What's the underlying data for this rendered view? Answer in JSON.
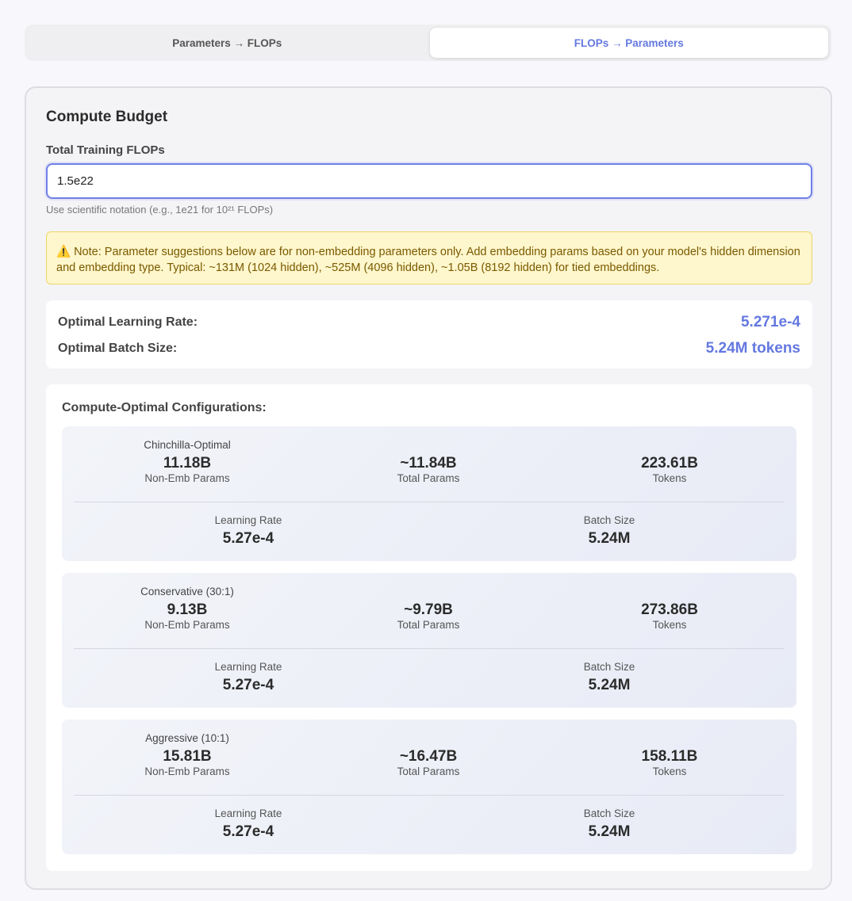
{
  "tabs": [
    {
      "label": "Parameters → FLOPs",
      "active": false
    },
    {
      "label": "FLOPs → Parameters",
      "active": true
    }
  ],
  "budget": {
    "title": "Compute Budget",
    "flops_label": "Total Training FLOPs",
    "flops_value": "1.5e22",
    "hint": "Use scientific notation (e.g., 1e21 for 10²¹ FLOPs)",
    "note": "⚠️ Note: Parameter suggestions below are for non-embedding parameters only. Add embedding params based on your model's hidden dimension and embedding type. Typical: ~131M (1024 hidden), ~525M (4096 hidden), ~1.05B (8192 hidden) for tied embeddings."
  },
  "summary": {
    "lr_label": "Optimal Learning Rate:",
    "lr_value": "5.271e-4",
    "bs_label": "Optimal Batch Size:",
    "bs_value": "5.24M tokens"
  },
  "configs": {
    "title": "Compute-Optimal Configurations:",
    "items": [
      {
        "name": "Chinchilla-Optimal",
        "non_emb": "11.18B",
        "non_emb_label": "Non-Emb Params",
        "total": "~11.84B",
        "total_label": "Total Params",
        "tokens": "223.61B",
        "tokens_label": "Tokens",
        "lr_label": "Learning Rate",
        "lr": "5.27e-4",
        "bs_label": "Batch Size",
        "bs": "5.24M"
      },
      {
        "name": "Conservative (30:1)",
        "non_emb": "9.13B",
        "non_emb_label": "Non-Emb Params",
        "total": "~9.79B",
        "total_label": "Total Params",
        "tokens": "273.86B",
        "tokens_label": "Tokens",
        "lr_label": "Learning Rate",
        "lr": "5.27e-4",
        "bs_label": "Batch Size",
        "bs": "5.24M"
      },
      {
        "name": "Aggressive (10:1)",
        "non_emb": "15.81B",
        "non_emb_label": "Non-Emb Params",
        "total": "~16.47B",
        "total_label": "Total Params",
        "tokens": "158.11B",
        "tokens_label": "Tokens",
        "lr_label": "Learning Rate",
        "lr": "5.27e-4",
        "bs_label": "Batch Size",
        "bs": "5.24M"
      }
    ]
  }
}
